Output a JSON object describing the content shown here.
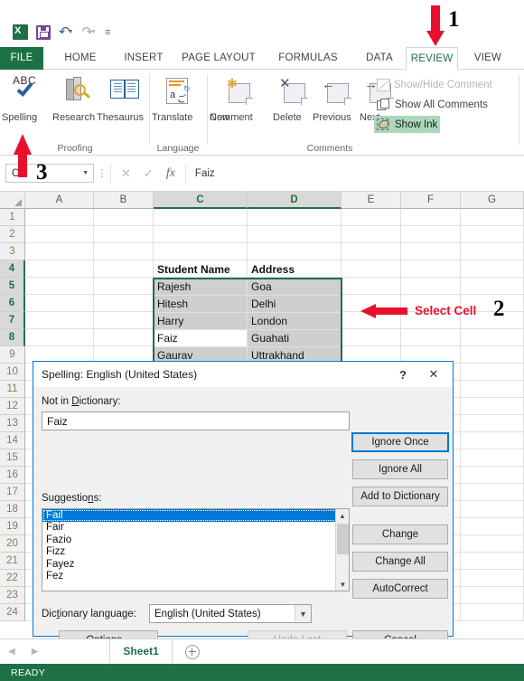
{
  "app": {
    "name": "Microsoft Excel 2013",
    "brand_color": "#1e7145",
    "accent_blue": "#0078d7",
    "annotation_color": "#e8112d"
  },
  "quick_access": {
    "items": [
      {
        "name": "excel-logo-icon",
        "label": "X"
      },
      {
        "name": "save-icon",
        "label": "Save"
      },
      {
        "name": "undo-icon",
        "label": "↶"
      },
      {
        "name": "redo-icon",
        "label": "↷"
      },
      {
        "name": "customize-qat-icon",
        "label": "═"
      }
    ]
  },
  "ribbon": {
    "tabs": [
      {
        "label": "FILE",
        "active": false,
        "file": true
      },
      {
        "label": "HOME",
        "active": false
      },
      {
        "label": "INSERT",
        "active": false
      },
      {
        "label": "PAGE LAYOUT",
        "active": false
      },
      {
        "label": "FORMULAS",
        "active": false
      },
      {
        "label": "DATA",
        "active": false
      },
      {
        "label": "REVIEW",
        "active": true
      },
      {
        "label": "VIEW",
        "active": false
      }
    ],
    "groups": [
      {
        "title": "Proofing"
      },
      {
        "title": "Language"
      },
      {
        "title": "Comments"
      }
    ],
    "proofing": {
      "spelling": "Spelling",
      "research": "Research",
      "thesaurus": "Thesaurus",
      "spelling_icon_text": "ABC"
    },
    "language": {
      "translate": "Translate"
    },
    "comments": {
      "new_comment_l1": "New",
      "new_comment_l2": "Comment",
      "delete": "Delete",
      "previous": "Previous",
      "next": "Next",
      "show_hide_comment": "Show/Hide Comment",
      "show_all_comments": "Show All Comments",
      "show_ink": "Show Ink",
      "show_ink_highlight": "#a9d9ba"
    }
  },
  "formula_bar": {
    "name_box_value": "C7",
    "cancel_icon": "✕",
    "enter_icon": "✓",
    "function_icon": "fx",
    "formula_value": "Faiz"
  },
  "grid": {
    "columns": [
      "A",
      "B",
      "C",
      "D",
      "E",
      "F",
      "G"
    ],
    "selected_columns": [
      "C",
      "D"
    ],
    "rows": [
      1,
      2,
      3,
      4,
      5,
      6,
      7,
      8,
      9,
      10,
      11,
      12,
      13,
      14,
      15,
      16,
      17,
      18,
      19,
      20,
      21,
      22,
      23,
      24
    ],
    "selected_rows": [
      4,
      5,
      6,
      7,
      8
    ],
    "table": {
      "headers": {
        "c": "Student Name",
        "d": "Address"
      },
      "header_row": 3,
      "data": [
        {
          "row": 4,
          "name": "Rajesh",
          "address": "Goa"
        },
        {
          "row": 5,
          "name": "Hitesh",
          "address": "Delhi"
        },
        {
          "row": 6,
          "name": "Harry",
          "address": "London"
        },
        {
          "row": 7,
          "name": "Faiz",
          "address": "Guahati"
        },
        {
          "row": 8,
          "name": "Gaurav",
          "address": "Uttrakhand"
        }
      ]
    },
    "selection_range": "C4:D8",
    "active_cell": "C7"
  },
  "annotations": [
    {
      "id": 1,
      "number": "1",
      "text": "",
      "target": "REVIEW tab"
    },
    {
      "id": 2,
      "number": "2",
      "text": "Select Cell",
      "target": "cell range"
    },
    {
      "id": 3,
      "number": "3",
      "text": "",
      "target": "Spelling button"
    }
  ],
  "dialog": {
    "title": "Spelling: English (United States)",
    "help_icon": "?",
    "close_icon": "✕",
    "not_in_dictionary_label_pre": "Not in ",
    "not_in_dictionary_label_accel": "D",
    "not_in_dictionary_label_post": "ictionary:",
    "not_in_dictionary_value": "Faiz",
    "suggestions_label_pre": "Suggestio",
    "suggestions_label_accel": "n",
    "suggestions_label_post": "s:",
    "suggestions": [
      "Fail",
      "Fair",
      "Fazio",
      "Fizz",
      "Fayez",
      "Fez"
    ],
    "selected_suggestion": "Fail",
    "dictionary_language_label_pre": "Dic",
    "dictionary_language_label_accel": "t",
    "dictionary_language_label_post": "ionary language:",
    "dictionary_language_value": "English (United States)",
    "buttons": {
      "ignore_once": "Ignore Once",
      "ignore_all": "Ignore All",
      "add_to_dictionary": "Add to Dictionary",
      "change": "Change",
      "change_all": "Change All",
      "autocorrect": "AutoCorrect",
      "cancel": "Cancel",
      "options": "Options...",
      "undo_last": "Undo Last"
    },
    "default_button": "Ignore Once",
    "disabled_buttons": [
      "Undo Last"
    ]
  },
  "sheet_bar": {
    "prev_icon": "◀",
    "next_icon": "▶",
    "sheets": [
      "Sheet1"
    ],
    "active_sheet": "Sheet1",
    "add_sheet_label": "+"
  },
  "status_bar": {
    "text": "READY"
  }
}
